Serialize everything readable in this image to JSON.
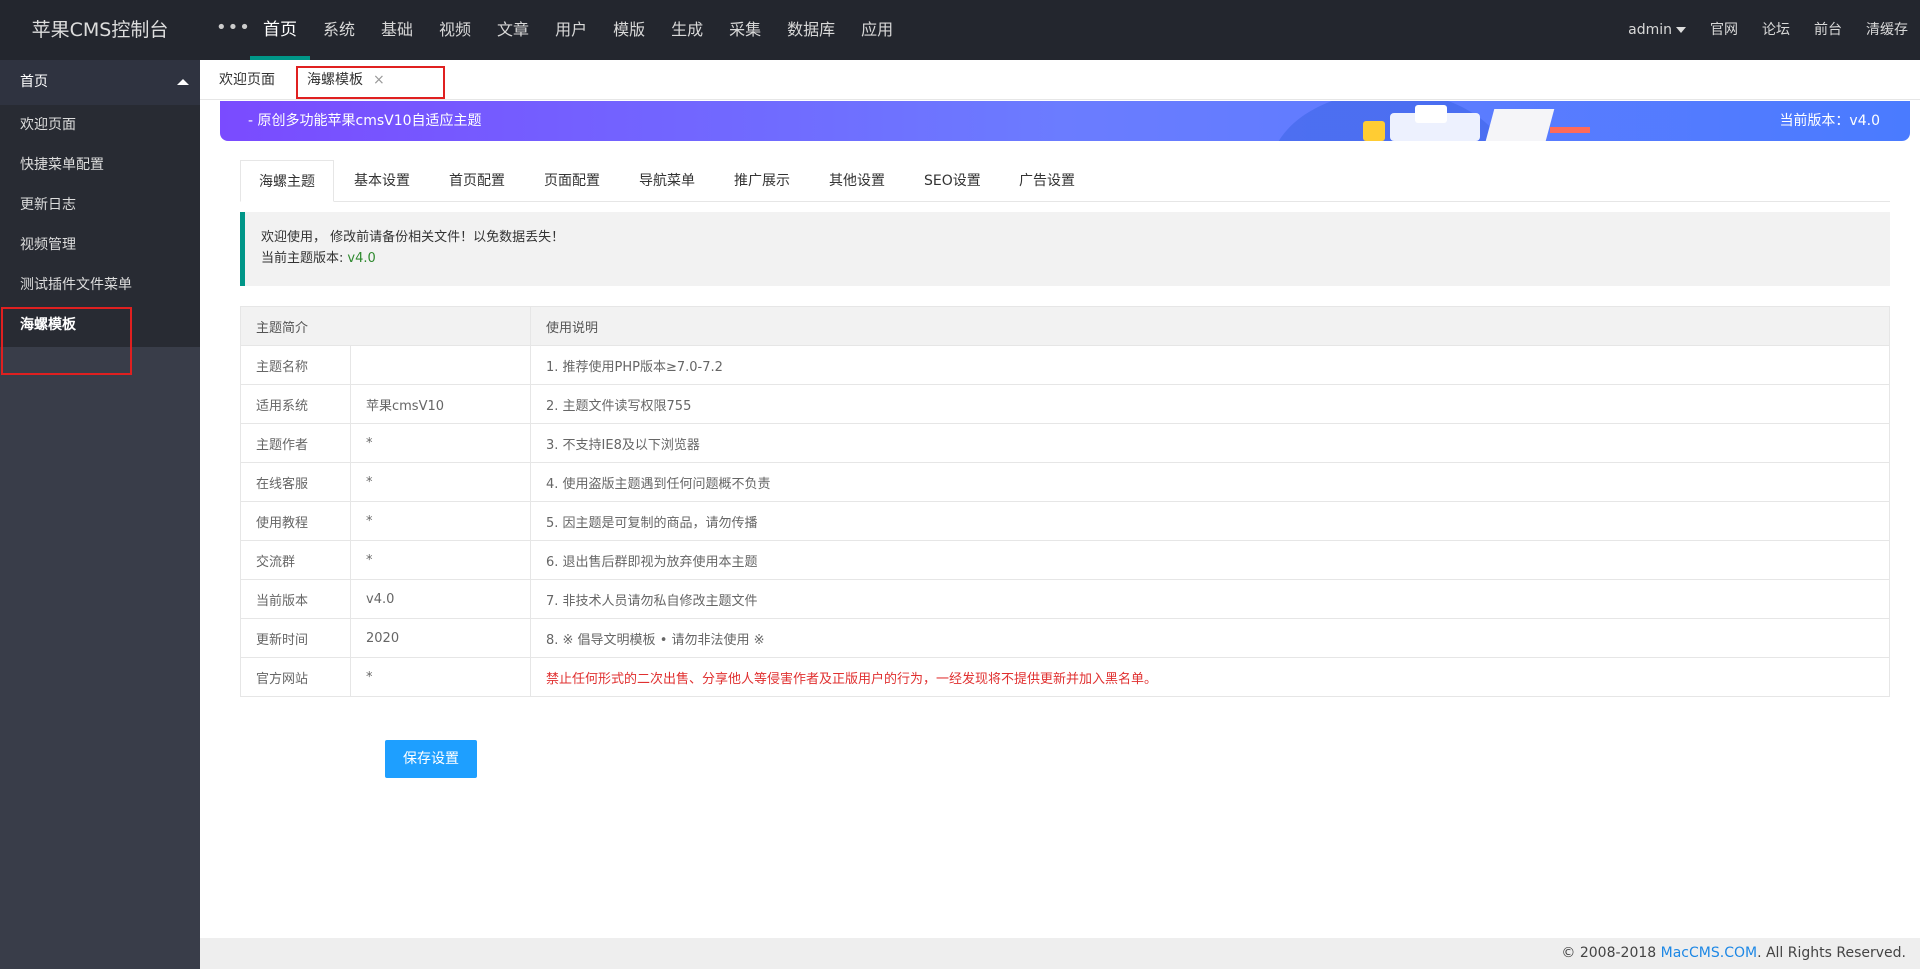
{
  "header": {
    "logo": "苹果CMS控制台",
    "more_label": "•••",
    "nav": [
      "首页",
      "系统",
      "基础",
      "视频",
      "文章",
      "用户",
      "模版",
      "生成",
      "采集",
      "数据库",
      "应用"
    ],
    "user": "admin",
    "links": [
      "官网",
      "论坛",
      "前台",
      "清缓存"
    ]
  },
  "sidebar": {
    "section": "首页",
    "items": [
      "欢迎页面",
      "快捷菜单配置",
      "更新日志",
      "视频管理",
      "测试插件文件菜单",
      "海螺模板"
    ]
  },
  "tabs": {
    "welcome": "欢迎页面",
    "current": "海螺模板",
    "close": "×"
  },
  "banner": {
    "text": "- 原创多功能苹果cmsV10自适应主题",
    "version": "当前版本：v4.0"
  },
  "subtabs": [
    "海螺主题",
    "基本设置",
    "首页配置",
    "页面配置",
    "导航菜单",
    "推广展示",
    "其他设置",
    "SEO设置",
    "广告设置"
  ],
  "notice": {
    "line1": "欢迎使用， 修改前请备份相关文件！以免数据丢失！",
    "line2_label": "当前主题版本:",
    "line2_value": "v4.0"
  },
  "table": {
    "headers": [
      "主题简介",
      "使用说明"
    ],
    "rows": [
      {
        "k": "主题名称",
        "v": "",
        "note": "1. 推荐使用PHP版本≥7.0-7.2"
      },
      {
        "k": "适用系统",
        "v": "苹果cmsV10",
        "note": "2. 主题文件读写权限755"
      },
      {
        "k": "主题作者",
        "v": "*",
        "note": "3. 不支持IE8及以下浏览器"
      },
      {
        "k": "在线客服",
        "v": "*",
        "note": "4. 使用盗版主题遇到任何问题概不负责"
      },
      {
        "k": "使用教程",
        "v": "*",
        "note": "5. 因主题是可复制的商品，请勿传播"
      },
      {
        "k": "交流群",
        "v": "*",
        "note": "6. 退出售后群即视为放弃使用本主题"
      },
      {
        "k": "当前版本",
        "v": "v4.0",
        "note": "7. 非技术人员请勿私自修改主题文件"
      },
      {
        "k": "更新时间",
        "v": "2020",
        "note": "8. ※ 倡导文明模板 • 请勿非法使用 ※"
      },
      {
        "k": "官方网站",
        "v": "*",
        "note": "禁止任何形式的二次出售、分享他人等侵害作者及正版用户的行为，一经发现将不提供更新并加入黑名单。"
      }
    ]
  },
  "save_label": "保存设置",
  "footer": {
    "prefix": "© 2008-2018 ",
    "link": "MacCMS.COM",
    "suffix": ". All Rights Reserved."
  },
  "colors": {
    "topbar": "#23262e",
    "sidebar": "#393d49",
    "accent": "#009688",
    "primary_button": "#1e9fff",
    "warning_text": "#e03030",
    "highlight_box": "#e02020"
  }
}
